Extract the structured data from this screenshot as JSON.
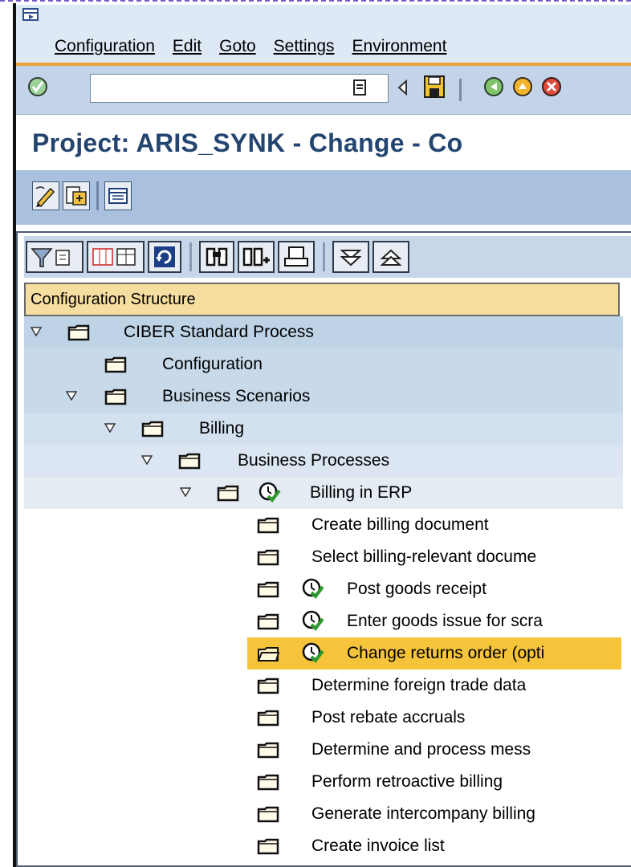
{
  "menu": [
    "Configuration",
    "Edit",
    "Goto",
    "Settings",
    "Environment"
  ],
  "toolbar": {
    "command_field_value": "",
    "icons": [
      "enter-icon",
      "command-dropdown-icon",
      "back-arrow-small-icon",
      "save-icon",
      "back-icon",
      "exit-icon",
      "cancel-icon"
    ]
  },
  "title": "Project: ARIS_SYNK - Change - Co",
  "app_toolbar_icons": [
    "edit-pencil-icon",
    "change-display-icon",
    "overview-icon"
  ],
  "tree_toolbar_icons": [
    "filter-icon",
    "columns-icon",
    "refresh-icon",
    "find-icon",
    "find-next-icon",
    "print-icon",
    "expand-all-icon",
    "collapse-all-icon"
  ],
  "tree": {
    "header": "Configuration Structure",
    "rows": [
      {
        "label": "CIBER Standard Process",
        "expanded": true,
        "clock": false
      },
      {
        "label": "Configuration",
        "expanded": null,
        "clock": false
      },
      {
        "label": "Business Scenarios",
        "expanded": true,
        "clock": false
      },
      {
        "label": "Billing",
        "expanded": true,
        "clock": false
      },
      {
        "label": "Business Processes",
        "expanded": true,
        "clock": false
      },
      {
        "label": "Billing in ERP",
        "expanded": true,
        "clock": true
      },
      {
        "label": "Create billing document",
        "clock": false
      },
      {
        "label": "Select billing-relevant docume",
        "clock": false
      },
      {
        "label": "Post goods receipt",
        "clock": true
      },
      {
        "label": "Enter goods issue for scra",
        "clock": true
      },
      {
        "label": "Change returns order (opti",
        "clock": true,
        "selected": true
      },
      {
        "label": "Determine foreign trade data",
        "clock": false
      },
      {
        "label": "Post rebate accruals",
        "clock": false
      },
      {
        "label": "Determine and process mess",
        "clock": false
      },
      {
        "label": "Perform retroactive billing",
        "clock": false
      },
      {
        "label": "Generate intercompany billing",
        "clock": false
      },
      {
        "label": "Create invoice list",
        "clock": false
      }
    ]
  }
}
